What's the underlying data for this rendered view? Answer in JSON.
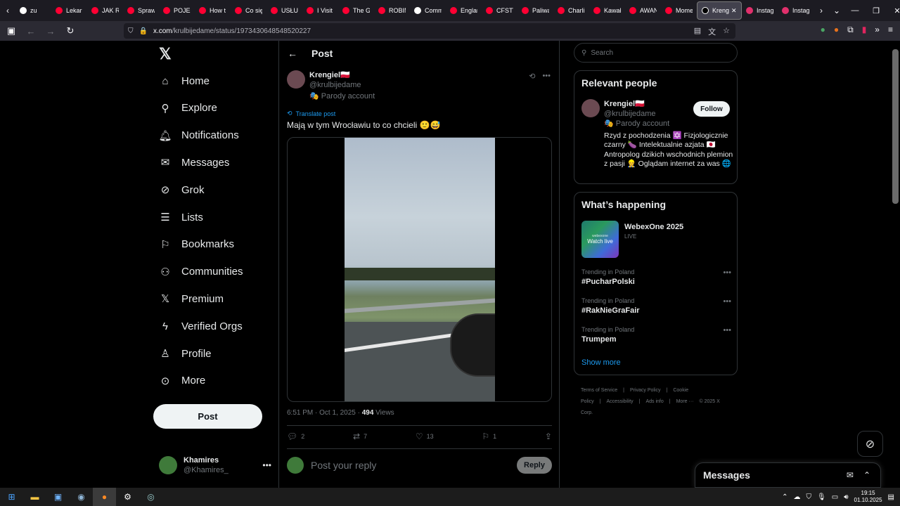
{
  "browser": {
    "tabs": [
      {
        "label": "zu",
        "color": "#ffffff"
      },
      {
        "label": "Lekar",
        "color": "#ff0033"
      },
      {
        "label": "JAK R",
        "color": "#ff0033"
      },
      {
        "label": "Spraw",
        "color": "#ff0033"
      },
      {
        "label": "POJEC",
        "color": "#ff0033"
      },
      {
        "label": "How t",
        "color": "#ff0033"
      },
      {
        "label": "Co się",
        "color": "#ff0033"
      },
      {
        "label": "USŁUC",
        "color": "#ff0033"
      },
      {
        "label": "I Visit",
        "color": "#ff0033"
      },
      {
        "label": "The G",
        "color": "#ff0033"
      },
      {
        "label": "ROBIM",
        "color": "#ff0033"
      },
      {
        "label": "Comm",
        "color": "#ffffff"
      },
      {
        "label": "Englar",
        "color": "#ff0033"
      },
      {
        "label": "CFSTV",
        "color": "#ff0033"
      },
      {
        "label": "Paliwa",
        "color": "#ff0033"
      },
      {
        "label": "Charli",
        "color": "#ff0033"
      },
      {
        "label": "Kawał",
        "color": "#ff0033"
      },
      {
        "label": "AWAN",
        "color": "#ff0033"
      },
      {
        "label": "Mome",
        "color": "#ff0033"
      }
    ],
    "active_tab": {
      "label": "Kreng"
    },
    "after_tabs": [
      {
        "label": "Instag",
        "color": "#e1306c"
      },
      {
        "label": "Instag",
        "color": "#e1306c"
      }
    ],
    "url_host": "x.com",
    "url_path": "/krulbijedame/status/1973430648548520227"
  },
  "nav": {
    "items": [
      {
        "label": "Home",
        "icon": "home-icon"
      },
      {
        "label": "Explore",
        "icon": "search-icon"
      },
      {
        "label": "Notifications",
        "icon": "bell-icon"
      },
      {
        "label": "Messages",
        "icon": "envelope-icon"
      },
      {
        "label": "Grok",
        "icon": "grok-icon"
      },
      {
        "label": "Lists",
        "icon": "list-icon"
      },
      {
        "label": "Bookmarks",
        "icon": "bookmark-icon"
      },
      {
        "label": "Communities",
        "icon": "people-icon"
      },
      {
        "label": "Premium",
        "icon": "x-logo-icon"
      },
      {
        "label": "Verified Orgs",
        "icon": "lightning-icon"
      },
      {
        "label": "Profile",
        "icon": "user-icon"
      },
      {
        "label": "More",
        "icon": "more-circle-icon"
      }
    ],
    "post_button": "Post",
    "me": {
      "name": "Khamires",
      "handle": "@Khamires_"
    }
  },
  "post": {
    "header": "Post",
    "author_name": "Krengiel🇵🇱",
    "author_handle": "@krulbijedame",
    "parody_label": "Parody account",
    "translate": "Translate post",
    "text": "Mają w tym Wrocławiu to co chcieli 🙂😅",
    "time": "6:51 PM · Oct 1, 2025 · ",
    "views_count": "494",
    "views_label": " Views",
    "replies": "2",
    "reposts": "7",
    "likes": "13",
    "bookmarks": "1",
    "reply_placeholder": "Post your reply",
    "reply_button": "Reply"
  },
  "sidebar": {
    "search_placeholder": "Search",
    "relevant_title": "Relevant people",
    "person_name": "Krengiel🇵🇱",
    "person_handle": "@krulbijedame",
    "person_parody": "Parody account",
    "follow": "Follow",
    "bio": "Rzyd z pochodzenia ✡️ Fizjologicznie czarny 🍆 Intelektualnie azjata 🇯🇵 Antropolog dzikich wschodnich plemion z pasji 👷 Oglądam internet za was 🌐",
    "happening_title": "What’s happening",
    "event_title": "WebexOne 2025",
    "event_sub": "LIVE",
    "event_img_label": "webexone",
    "event_img_text": "Watch live",
    "trends": [
      {
        "context": "Trending in Poland",
        "tag": "#PucharPolski"
      },
      {
        "context": "Trending in Poland",
        "tag": "#RakNieGraFair"
      },
      {
        "context": "Trending in Poland",
        "tag": "Trumpem"
      }
    ],
    "show_more": "Show more",
    "footer": [
      "Terms of Service",
      "|",
      "Privacy Policy",
      "|",
      "Cookie Policy",
      "|",
      "Accessibility",
      "|",
      "Ads info",
      "|",
      "More ···",
      "© 2025 X Corp."
    ]
  },
  "messages_drawer": {
    "title": "Messages"
  },
  "taskbar": {
    "time": "19:15",
    "date": "01.10.2025"
  }
}
